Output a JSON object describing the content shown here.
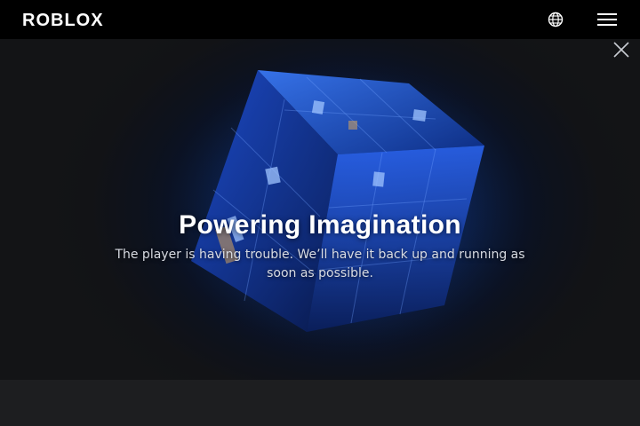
{
  "header": {
    "logo_text": "ROBLOX",
    "globe_icon": "globe-icon",
    "menu_icon": "hamburger-menu-icon"
  },
  "hero": {
    "close_icon": "close-icon",
    "title": "Powering Imagination",
    "message": "The player is having trouble. We’ll have it back up and running as soon as possible."
  },
  "colors": {
    "topbar": "#000000",
    "background": "#1b1c1e",
    "cube_blue": "#1f5bff",
    "text": "#ffffff"
  }
}
